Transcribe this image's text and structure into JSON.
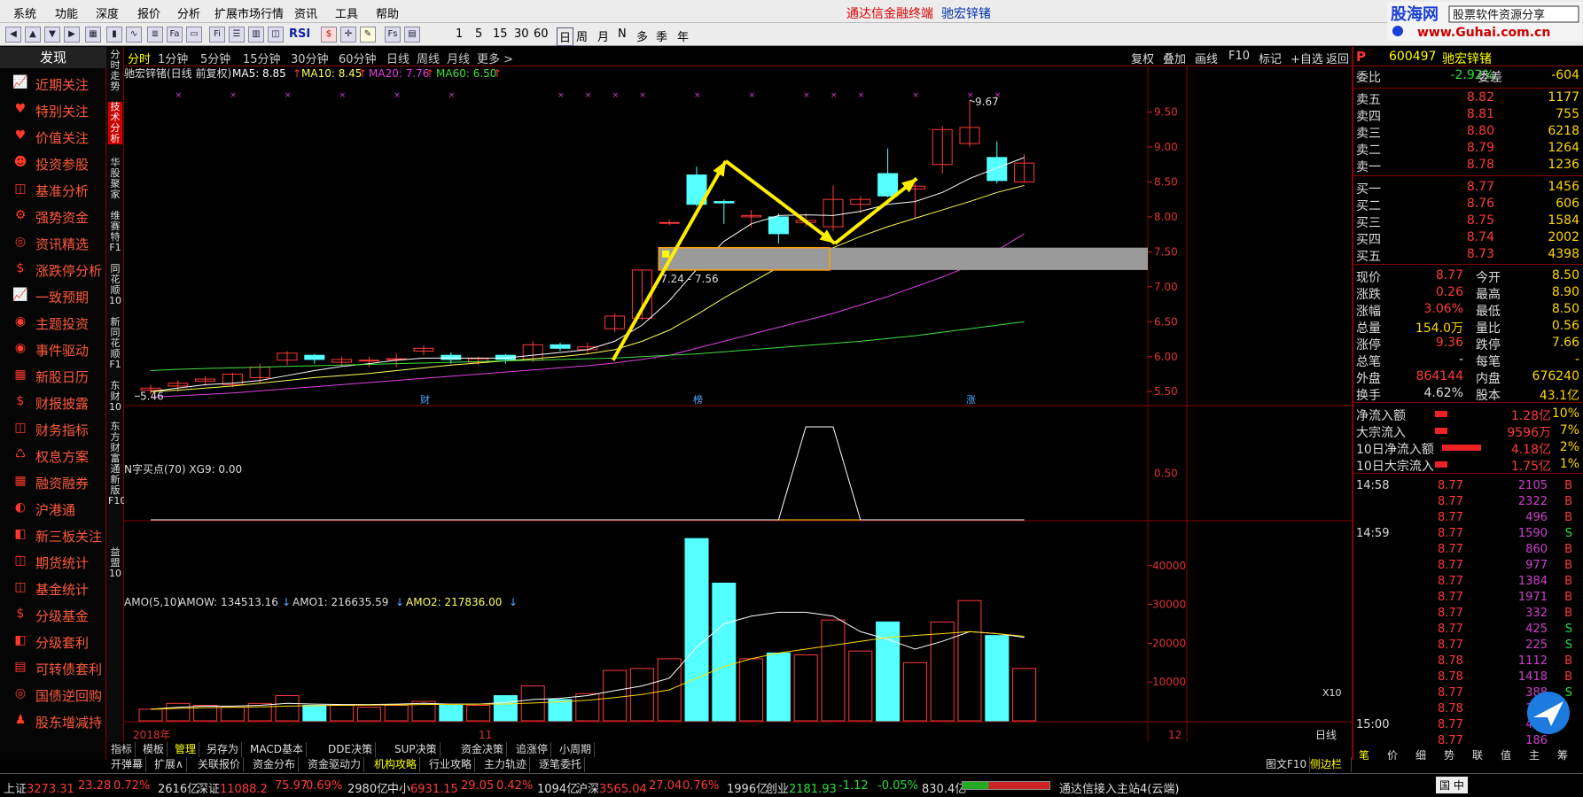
{
  "menu": [
    "系统",
    "功能",
    "深度",
    "报价",
    "分析",
    "扩展市场行情",
    "资讯",
    "工具",
    "帮助"
  ],
  "app_title": "通达信金融终端",
  "stock_title": "驰宏锌锗",
  "logo": {
    "main": "股海网",
    "sub": "股票软件资源分享",
    "url": "www.Guhai.com.cn"
  },
  "toolbar": {
    "numbers": [
      "1",
      "5",
      "15",
      "30",
      "60"
    ],
    "periods": [
      "日",
      "周",
      "月",
      "N",
      "多",
      "季",
      "年"
    ],
    "rsi": "RSI"
  },
  "sidebar": {
    "header": "发现",
    "items": [
      "近期关注",
      "特别关注",
      "价值关注",
      "投资参股",
      "基准分析",
      "强势资金",
      "资讯精选",
      "涨跌停分析",
      "一致预期",
      "主题投资",
      "事件驱动",
      "新股日历",
      "财报披露",
      "财务指标",
      "权息方案",
      "融资融券",
      "沪港通",
      "新三板关注",
      "期货统计",
      "基金统计",
      "分级基金",
      "分级套利",
      "可转债套利",
      "国债逆回购",
      "股东增减持"
    ]
  },
  "vtabs": [
    "分时走势",
    "技术分析",
    "华股聚家",
    "维赛特F1",
    "同花顺10",
    "新同花顺F1",
    "东财10",
    "东方财富通新版F10",
    "益盟10"
  ],
  "periodbar": {
    "items": [
      "分时",
      "1分钟",
      "5分钟",
      "15分钟",
      "30分钟",
      "60分钟",
      "日线",
      "周线",
      "月线",
      "更多 >"
    ],
    "right": [
      "复权",
      "叠加",
      "画线",
      "F10",
      "标记",
      "+自选",
      "返回"
    ]
  },
  "kline": {
    "header_name": "驰宏锌锗(日线 前复权)",
    "ma5": "MA5: 8.85",
    "ma10": "MA10: 8.45",
    "ma20": "MA20: 7.76",
    "ma60": "MA60: 6.50",
    "high_label": "9.67",
    "low_label": "5.46",
    "zone_label": "7.24 - 7.56",
    "markers": [
      "财",
      "榜",
      "涨"
    ],
    "y_ticks": [
      "9.50",
      "9.00",
      "8.50",
      "8.00",
      "7.50",
      "7.00",
      "6.50",
      "6.00",
      "5.50"
    ],
    "candles": [
      {
        "o": 5.52,
        "c": 5.55,
        "h": 5.6,
        "l": 5.46
      },
      {
        "o": 5.58,
        "c": 5.62,
        "h": 5.66,
        "l": 5.5
      },
      {
        "o": 5.65,
        "c": 5.68,
        "h": 5.72,
        "l": 5.58
      },
      {
        "o": 5.6,
        "c": 5.75,
        "h": 5.77,
        "l": 5.56
      },
      {
        "o": 5.7,
        "c": 5.85,
        "h": 5.9,
        "l": 5.62
      },
      {
        "o": 5.95,
        "c": 6.05,
        "h": 6.08,
        "l": 5.88
      },
      {
        "o": 6.02,
        "c": 5.96,
        "h": 6.04,
        "l": 5.9
      },
      {
        "o": 5.92,
        "c": 5.96,
        "h": 6.0,
        "l": 5.86
      },
      {
        "o": 5.94,
        "c": 5.95,
        "h": 6.0,
        "l": 5.85
      },
      {
        "o": 5.96,
        "c": 5.97,
        "h": 6.05,
        "l": 5.85
      },
      {
        "o": 6.08,
        "c": 6.12,
        "h": 6.16,
        "l": 6.02
      },
      {
        "o": 6.02,
        "c": 5.96,
        "h": 6.06,
        "l": 5.9
      },
      {
        "o": 5.92,
        "c": 5.97,
        "h": 6.0,
        "l": 5.88
      },
      {
        "o": 6.02,
        "c": 5.96,
        "h": 6.04,
        "l": 5.9
      },
      {
        "o": 5.95,
        "c": 6.17,
        "h": 6.22,
        "l": 5.92
      },
      {
        "o": 6.17,
        "c": 6.12,
        "h": 6.2,
        "l": 6.08
      },
      {
        "o": 6.1,
        "c": 6.14,
        "h": 6.2,
        "l": 6.05
      },
      {
        "o": 6.4,
        "c": 6.58,
        "h": 6.62,
        "l": 6.35
      },
      {
        "o": 6.55,
        "c": 7.24,
        "h": 7.24,
        "l": 6.52
      },
      {
        "o": 7.92,
        "c": 7.92,
        "h": 7.96,
        "l": 7.88
      },
      {
        "o": 8.6,
        "c": 8.18,
        "h": 8.72,
        "l": 8.15
      },
      {
        "o": 8.22,
        "c": 8.2,
        "h": 8.25,
        "l": 7.9
      },
      {
        "o": 8.0,
        "c": 8.02,
        "h": 8.1,
        "l": 7.85
      },
      {
        "o": 8.0,
        "c": 7.76,
        "h": 8.05,
        "l": 7.62
      },
      {
        "o": 7.92,
        "c": 7.95,
        "h": 8.05,
        "l": 7.86
      },
      {
        "o": 7.86,
        "c": 8.25,
        "h": 8.45,
        "l": 7.8
      },
      {
        "o": 8.18,
        "c": 8.25,
        "h": 8.3,
        "l": 8.05
      },
      {
        "o": 8.62,
        "c": 8.3,
        "h": 8.98,
        "l": 8.28
      },
      {
        "o": 8.4,
        "c": 8.44,
        "h": 8.48,
        "l": 7.98
      },
      {
        "o": 8.75,
        "c": 9.25,
        "h": 9.3,
        "l": 8.62
      },
      {
        "o": 9.05,
        "c": 9.28,
        "h": 9.67,
        "l": 9.0
      },
      {
        "o": 8.85,
        "c": 8.52,
        "h": 9.08,
        "l": 8.48
      },
      {
        "o": 8.5,
        "c": 8.77,
        "h": 8.9,
        "l": 8.5
      }
    ],
    "ma_lines": {
      "ma5": [
        5.5,
        5.55,
        5.6,
        5.62,
        5.66,
        5.73,
        5.8,
        5.86,
        5.9,
        5.95,
        5.98,
        5.98,
        5.98,
        5.98,
        6.02,
        6.06,
        6.1,
        6.22,
        6.45,
        6.8,
        7.25,
        7.65,
        7.9,
        8.02,
        8.03,
        8.02,
        8.08,
        8.18,
        8.22,
        8.35,
        8.55,
        8.7,
        8.85
      ],
      "ma10": [
        5.5,
        5.52,
        5.55,
        5.58,
        5.62,
        5.66,
        5.7,
        5.73,
        5.76,
        5.8,
        5.84,
        5.88,
        5.91,
        5.94,
        5.97,
        6.0,
        6.04,
        6.1,
        6.22,
        6.38,
        6.6,
        6.84,
        7.06,
        7.28,
        7.44,
        7.56,
        7.72,
        7.86,
        7.98,
        8.1,
        8.22,
        8.35,
        8.45
      ],
      "ma20": [
        5.42,
        5.44,
        5.46,
        5.48,
        5.51,
        5.54,
        5.57,
        5.6,
        5.63,
        5.66,
        5.69,
        5.72,
        5.75,
        5.78,
        5.81,
        5.84,
        5.87,
        5.91,
        5.96,
        6.02,
        6.12,
        6.22,
        6.32,
        6.42,
        6.52,
        6.62,
        6.74,
        6.86,
        7.0,
        7.14,
        7.3,
        7.52,
        7.76
      ],
      "ma60": [
        5.8,
        5.82,
        5.83,
        5.84,
        5.85,
        5.86,
        5.87,
        5.88,
        5.89,
        5.9,
        5.91,
        5.92,
        5.93,
        5.94,
        5.95,
        5.96,
        5.97,
        5.98,
        6.0,
        6.02,
        6.04,
        6.07,
        6.1,
        6.13,
        6.16,
        6.19,
        6.22,
        6.26,
        6.3,
        6.35,
        6.4,
        6.45,
        6.5
      ]
    }
  },
  "n_indicator": {
    "header": "N字买点(70)  XG9: 0.00",
    "y_tick": "0.50",
    "signal": [
      0,
      0,
      0,
      0,
      0,
      0,
      0,
      0,
      0,
      0,
      0,
      0,
      0,
      0,
      0,
      0,
      0,
      0,
      0,
      0,
      0,
      0,
      0,
      0,
      1,
      1,
      0,
      0,
      0,
      0,
      0,
      0,
      0
    ]
  },
  "amo": {
    "header_label": "AMO(5,10)",
    "amow": "AMOW: 134513.16",
    "amo1": "AMO1: 216635.59",
    "amo2": "AMO2: 217836.00",
    "y_ticks": [
      "40000",
      "30000",
      "20000",
      "10000"
    ],
    "x_unit": "X10",
    "values": [
      3000,
      4500,
      4000,
      3500,
      4500,
      6500,
      4000,
      4000,
      3500,
      4000,
      5000,
      4000,
      4000,
      6500,
      9000,
      5500,
      7000,
      13000,
      13500,
      16000,
      47000,
      35500,
      16000,
      17500,
      17000,
      26000,
      18000,
      25500,
      15000,
      25500,
      31000,
      22000,
      13500
    ],
    "amo1_line": [
      3000,
      3500,
      3800,
      3800,
      4000,
      4500,
      4300,
      4200,
      4200,
      4300,
      4500,
      4300,
      4300,
      4700,
      5500,
      5800,
      6500,
      7800,
      9000,
      11000,
      19000,
      25000,
      27000,
      28000,
      28000,
      27000,
      23000,
      21000,
      18500,
      20500,
      23000,
      22500,
      21500
    ],
    "amo2_line": [
      3000,
      3200,
      3400,
      3500,
      3600,
      3800,
      3900,
      4000,
      4050,
      4100,
      4200,
      4250,
      4300,
      4350,
      4600,
      4900,
      5300,
      6000,
      6800,
      8000,
      11000,
      14000,
      16000,
      17500,
      18500,
      19500,
      20500,
      21500,
      22000,
      22500,
      23000,
      22500,
      21800
    ]
  },
  "x_axis": {
    "year": "2018年",
    "m11": "11",
    "m12": "12",
    "period": "日线"
  },
  "bottom_tabs_row1": [
    "指标",
    "模板",
    "管理",
    "另存为",
    "MACD基本",
    "DDE决策",
    "SUP决策",
    "资金决策",
    "追涨停",
    "小周期"
  ],
  "bottom_tabs_row2": [
    "开弹幕",
    "扩展∧",
    "关联报价",
    "资金分布",
    "资金驱动力",
    "机构攻略",
    "行业攻略",
    "主力轨迹",
    "逐笔委托"
  ],
  "bottom_right": [
    "图文F10",
    "侧边栏<"
  ],
  "quote": {
    "code": "600497",
    "name": "驰宏锌锗",
    "weibi_label": "委比",
    "weibi": "-2.92%",
    "weicha_label": "委差",
    "weicha": "-604",
    "asks": [
      {
        "label": "卖五",
        "price": "8.82",
        "vol": "1177"
      },
      {
        "label": "卖四",
        "price": "8.81",
        "vol": "755"
      },
      {
        "label": "卖三",
        "price": "8.80",
        "vol": "6218"
      },
      {
        "label": "卖二",
        "price": "8.79",
        "vol": "1264"
      },
      {
        "label": "卖一",
        "price": "8.78",
        "vol": "1236"
      }
    ],
    "bids": [
      {
        "label": "买一",
        "price": "8.77",
        "vol": "1456"
      },
      {
        "label": "买二",
        "price": "8.76",
        "vol": "606"
      },
      {
        "label": "买三",
        "price": "8.75",
        "vol": "1584"
      },
      {
        "label": "买四",
        "price": "8.74",
        "vol": "2002"
      },
      {
        "label": "买五",
        "price": "8.73",
        "vol": "4398"
      }
    ],
    "stats": [
      {
        "k1": "现价",
        "v1": "8.77",
        "c1": "red",
        "k2": "今开",
        "v2": "8.50",
        "c2": "red"
      },
      {
        "k1": "涨跌",
        "v1": "0.26",
        "c1": "red",
        "k2": "最高",
        "v2": "8.90",
        "c2": "red"
      },
      {
        "k1": "涨幅",
        "v1": "3.06%",
        "c1": "red",
        "k2": "最低",
        "v2": "8.50",
        "c2": "red"
      },
      {
        "k1": "总量",
        "v1": "154.0万",
        "c1": "yel",
        "k2": "量比",
        "v2": "0.56",
        "c2": "yel"
      },
      {
        "k1": "涨停",
        "v1": "9.36",
        "c1": "red",
        "k2": "跌停",
        "v2": "7.66",
        "c2": "green"
      },
      {
        "k1": "总笔",
        "v1": "-",
        "c1": "wht",
        "k2": "每笔",
        "v2": "-",
        "c2": "wht"
      },
      {
        "k1": "外盘",
        "v1": "864144",
        "c1": "red",
        "k2": "内盘",
        "v2": "676240",
        "c2": "green"
      },
      {
        "k1": "换手",
        "v1": "4.62%",
        "c1": "wht",
        "k2": "股本",
        "v2": "43.1亿",
        "c2": "wht"
      }
    ],
    "flows": [
      {
        "k": "净流入额",
        "v": "1.28亿",
        "p": "10%"
      },
      {
        "k": "大宗流入",
        "v": "9596万",
        "p": "7%"
      },
      {
        "k": "10日净流入额",
        "v": "4.18亿",
        "p": "2%"
      },
      {
        "k": "10日大宗流入",
        "v": "1.75亿",
        "p": "1%"
      }
    ],
    "ticks": [
      {
        "t": "14:58",
        "p": "8.77",
        "v": "2105",
        "s": "B"
      },
      {
        "t": "",
        "p": "8.77",
        "v": "2322",
        "s": "B"
      },
      {
        "t": "",
        "p": "8.77",
        "v": "496",
        "s": "B"
      },
      {
        "t": "14:59",
        "p": "8.77",
        "v": "1590",
        "s": "S"
      },
      {
        "t": "",
        "p": "8.77",
        "v": "860",
        "s": "B"
      },
      {
        "t": "",
        "p": "8.77",
        "v": "977",
        "s": "B"
      },
      {
        "t": "",
        "p": "8.77",
        "v": "1384",
        "s": "B"
      },
      {
        "t": "",
        "p": "8.77",
        "v": "1971",
        "s": "B"
      },
      {
        "t": "",
        "p": "8.77",
        "v": "332",
        "s": "B"
      },
      {
        "t": "",
        "p": "8.77",
        "v": "425",
        "s": "S"
      },
      {
        "t": "",
        "p": "8.77",
        "v": "225",
        "s": "S"
      },
      {
        "t": "",
        "p": "8.78",
        "v": "1112",
        "s": "B"
      },
      {
        "t": "",
        "p": "8.78",
        "v": "1418",
        "s": "B"
      },
      {
        "t": "",
        "p": "8.77",
        "v": "388",
        "s": "S"
      },
      {
        "t": "",
        "p": "8.78",
        "v": "151",
        "s": ""
      },
      {
        "t": "15:00",
        "p": "8.77",
        "v": "494",
        "s": ""
      },
      {
        "t": "",
        "p": "8.77",
        "v": "186",
        "s": ""
      }
    ],
    "tabs": [
      "笔",
      "价",
      "细",
      "势",
      "联",
      "值",
      "主",
      "筹"
    ]
  },
  "status": {
    "sh": {
      "label": "上证",
      "idx": "3273.31",
      "chg": "23.28",
      "pct": "0.72%",
      "amt": "2616亿"
    },
    "sz": {
      "label": "深证",
      "idx": "11088.2",
      "chg": "75.97",
      "pct": "0.69%",
      "amt": "2980亿"
    },
    "zx": {
      "label": "中小",
      "idx": "6931.15",
      "chg": "29.05",
      "pct": "0.42%",
      "amt": "1094亿"
    },
    "hs": {
      "label": "沪深",
      "idx": "3565.04",
      "chg": "27.04",
      "pct": "0.76%",
      "amt": "1996亿"
    },
    "cy": {
      "label": "创业",
      "idx": "2181.93",
      "chg": "-1.12",
      "pct": "-0.05%",
      "amt": "830.4亿"
    },
    "conn": "通达信接入主站4(云端)",
    "ime": "国 中"
  },
  "colors": {
    "up": "#ff3a3a",
    "down": "#54ffff",
    "ma5": "#ffffff",
    "ma10": "#ffff55",
    "ma20": "#e040e0",
    "ma60": "#40e040",
    "arrow": "#ffee00",
    "border": "#8a0000"
  }
}
